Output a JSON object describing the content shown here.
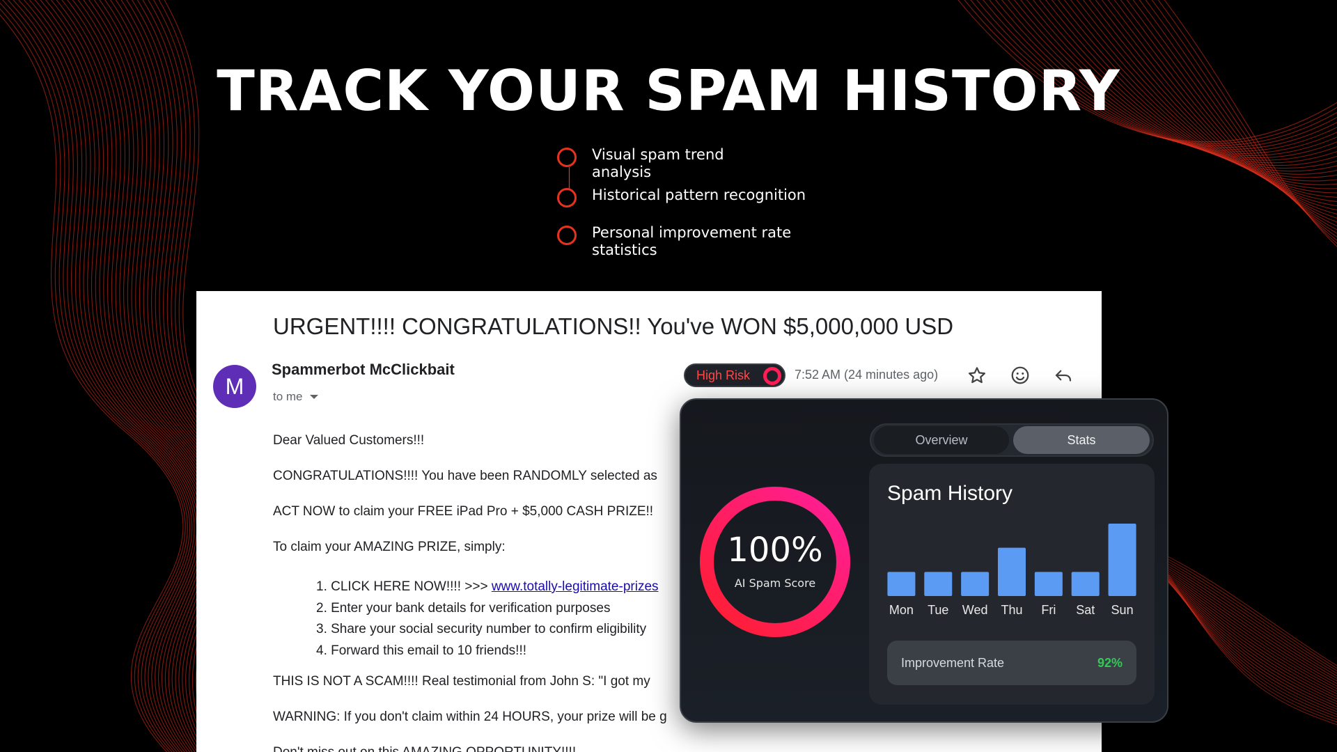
{
  "headline": "TRACK YOUR SPAM HISTORY",
  "features": [
    {
      "text": "Visual spam trend analysis"
    },
    {
      "text": "Historical pattern recognition"
    },
    {
      "text": "Personal improvement rate statistics"
    }
  ],
  "email": {
    "subject": "URGENT!!!! CONGRATULATIONS!! You've WON $5,000,000 USD",
    "sender_initial": "M",
    "sender_name": "Spammerbot McClickbait",
    "to": "to me",
    "risk_label": "High Risk",
    "timestamp": "7:52 AM (24 minutes ago)",
    "body": {
      "greeting": "Dear Valued Customers!!!",
      "line1": "CONGRATULATIONS!!!! You have been RANDOMLY selected as",
      "line2": "ACT NOW to claim your FREE iPad Pro + $5,000 CASH PRIZE!!",
      "line3": "To claim your AMAZING PRIZE, simply:",
      "steps": [
        {
          "prefix": "1. CLICK HERE NOW!!!! >>> ",
          "link": "www.totally-legitimate-prizes"
        },
        {
          "text": "2. Enter your bank details for verification purposes"
        },
        {
          "text": "3. Share your social security number to confirm eligibility"
        },
        {
          "text": "4. Forward this email to 10 friends!!!"
        }
      ],
      "line4": "THIS IS NOT A SCAM!!!! Real testimonial from John S: \"I got my",
      "line5": "WARNING: If you don't claim within 24 HOURS, your prize will be g",
      "line6": "Don't miss out on this AMAZING OPPORTUNITY!!!!"
    }
  },
  "card": {
    "tabs": {
      "overview": "Overview",
      "stats": "Stats"
    },
    "score": {
      "value": "100%",
      "label": "AI Spam Score",
      "fraction": 1.0
    },
    "history_title": "Spam History",
    "improvement": {
      "label": "Improvement Rate",
      "value": "92%"
    }
  },
  "chart_data": {
    "type": "bar",
    "categories": [
      "Mon",
      "Tue",
      "Wed",
      "Thu",
      "Fri",
      "Sat",
      "Sun"
    ],
    "values": [
      1,
      1,
      1,
      2,
      1,
      1,
      3
    ],
    "title": "Spam History",
    "color": "#5c9bf4"
  },
  "colors": {
    "accent_red": "#e8321f",
    "risk_red": "#ff4a4a",
    "ring_start": "#ff1e2d",
    "ring_end": "#ff1e9a",
    "link_blue": "#1a0dab",
    "improve_green": "#35c759"
  },
  "icons": {
    "star": "star-icon",
    "emoji": "emoji-icon",
    "reply": "reply-icon"
  }
}
